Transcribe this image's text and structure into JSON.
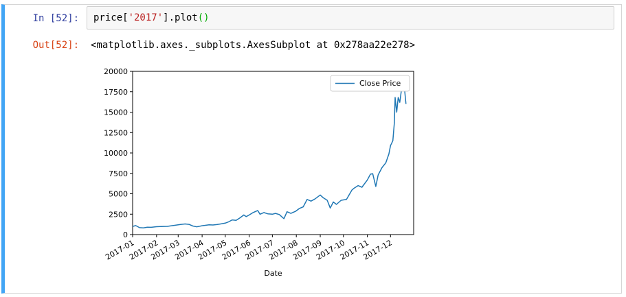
{
  "cell": {
    "in_prompt": "In [52]:",
    "out_prompt": "Out[52]:",
    "code": {
      "part1": "price[",
      "part2": "'2017'",
      "part3": "].plot",
      "part4": "()"
    },
    "output_text": "<matplotlib.axes._subplots.AxesSubplot at 0x278aa22e278>"
  },
  "colors": {
    "cell_border_accent": "#42a5f5",
    "line": "#1f77b4",
    "in_prompt": "#303f9f",
    "out_prompt": "#d84315"
  },
  "chart_data": {
    "type": "line",
    "xlabel": "Date",
    "ylabel": "",
    "ylim": [
      0,
      20000
    ],
    "xlim": [
      "2017-01-01",
      "2017-12-31"
    ],
    "yticks": [
      0,
      2500,
      5000,
      7500,
      10000,
      12500,
      15000,
      17500,
      20000
    ],
    "xticks": [
      {
        "date": "2017-01-01",
        "label": "2017-01"
      },
      {
        "date": "2017-02-01",
        "label": "2017-02"
      },
      {
        "date": "2017-03-01",
        "label": "2017-03"
      },
      {
        "date": "2017-04-01",
        "label": "2017-04"
      },
      {
        "date": "2017-05-01",
        "label": "2017-05"
      },
      {
        "date": "2017-06-01",
        "label": "2017-06"
      },
      {
        "date": "2017-07-01",
        "label": "2017-07"
      },
      {
        "date": "2017-08-01",
        "label": "2017-08"
      },
      {
        "date": "2017-09-01",
        "label": "2017-09"
      },
      {
        "date": "2017-10-01",
        "label": "2017-10"
      },
      {
        "date": "2017-11-01",
        "label": "2017-11"
      },
      {
        "date": "2017-12-01",
        "label": "2017-12"
      }
    ],
    "legend": "top-right",
    "grid": false,
    "series": [
      {
        "name": "Close Price",
        "points": [
          [
            "2017-01-01",
            1000
          ],
          [
            "2017-01-05",
            1100
          ],
          [
            "2017-01-10",
            850
          ],
          [
            "2017-01-15",
            820
          ],
          [
            "2017-01-20",
            900
          ],
          [
            "2017-01-25",
            890
          ],
          [
            "2017-02-01",
            970
          ],
          [
            "2017-02-10",
            1000
          ],
          [
            "2017-02-15",
            1010
          ],
          [
            "2017-02-22",
            1100
          ],
          [
            "2017-03-01",
            1200
          ],
          [
            "2017-03-05",
            1250
          ],
          [
            "2017-03-10",
            1300
          ],
          [
            "2017-03-15",
            1250
          ],
          [
            "2017-03-20",
            1050
          ],
          [
            "2017-03-25",
            950
          ],
          [
            "2017-04-01",
            1080
          ],
          [
            "2017-04-10",
            1200
          ],
          [
            "2017-04-15",
            1180
          ],
          [
            "2017-04-20",
            1230
          ],
          [
            "2017-04-25",
            1300
          ],
          [
            "2017-05-01",
            1400
          ],
          [
            "2017-05-05",
            1550
          ],
          [
            "2017-05-10",
            1800
          ],
          [
            "2017-05-15",
            1750
          ],
          [
            "2017-05-20",
            2050
          ],
          [
            "2017-05-25",
            2400
          ],
          [
            "2017-05-28",
            2200
          ],
          [
            "2017-06-01",
            2400
          ],
          [
            "2017-06-06",
            2700
          ],
          [
            "2017-06-12",
            2950
          ],
          [
            "2017-06-15",
            2500
          ],
          [
            "2017-06-20",
            2700
          ],
          [
            "2017-06-25",
            2550
          ],
          [
            "2017-07-01",
            2500
          ],
          [
            "2017-07-05",
            2600
          ],
          [
            "2017-07-10",
            2450
          ],
          [
            "2017-07-16",
            1950
          ],
          [
            "2017-07-20",
            2800
          ],
          [
            "2017-07-25",
            2600
          ],
          [
            "2017-07-31",
            2850
          ],
          [
            "2017-08-05",
            3200
          ],
          [
            "2017-08-10",
            3400
          ],
          [
            "2017-08-15",
            4300
          ],
          [
            "2017-08-20",
            4100
          ],
          [
            "2017-08-25",
            4350
          ],
          [
            "2017-09-01",
            4850
          ],
          [
            "2017-09-05",
            4500
          ],
          [
            "2017-09-10",
            4200
          ],
          [
            "2017-09-14",
            3250
          ],
          [
            "2017-09-18",
            4000
          ],
          [
            "2017-09-22",
            3700
          ],
          [
            "2017-09-28",
            4200
          ],
          [
            "2017-10-05",
            4300
          ],
          [
            "2017-10-12",
            5450
          ],
          [
            "2017-10-15",
            5700
          ],
          [
            "2017-10-20",
            6000
          ],
          [
            "2017-10-25",
            5800
          ],
          [
            "2017-11-01",
            6700
          ],
          [
            "2017-11-05",
            7400
          ],
          [
            "2017-11-08",
            7450
          ],
          [
            "2017-11-12",
            5900
          ],
          [
            "2017-11-15",
            7300
          ],
          [
            "2017-11-20",
            8200
          ],
          [
            "2017-11-25",
            8800
          ],
          [
            "2017-11-29",
            9900
          ],
          [
            "2017-12-01",
            10900
          ],
          [
            "2017-12-04",
            11500
          ],
          [
            "2017-12-06",
            13700
          ],
          [
            "2017-12-07",
            16800
          ],
          [
            "2017-12-09",
            15000
          ],
          [
            "2017-12-11",
            16800
          ],
          [
            "2017-12-13",
            16200
          ],
          [
            "2017-12-15",
            17600
          ],
          [
            "2017-12-17",
            19200
          ],
          [
            "2017-12-19",
            18000
          ],
          [
            "2017-12-21",
            16000
          ]
        ]
      }
    ]
  }
}
